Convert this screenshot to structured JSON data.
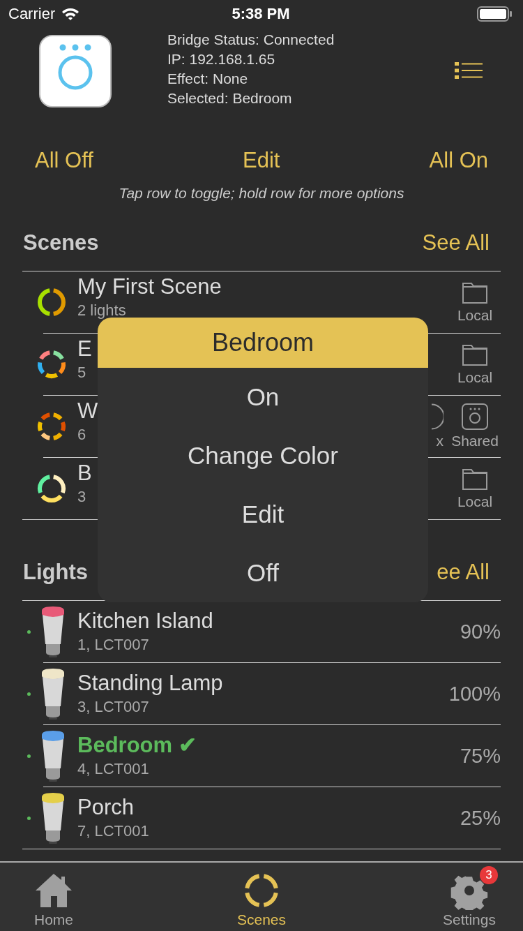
{
  "status_bar": {
    "carrier": "Carrier",
    "time": "5:38 PM"
  },
  "bridge": {
    "lines": [
      "Bridge Status: Connected",
      "IP: 192.168.1.65",
      "Effect: None",
      "Selected: Bedroom"
    ]
  },
  "actions": [
    "All Off",
    "Edit",
    "All On"
  ],
  "hint": "Tap row to toggle; hold row for more options",
  "scenes": {
    "title": "Scenes",
    "see_all": "See All",
    "rows": [
      {
        "name": "My First Scene",
        "subtitle": "2 lights",
        "segments": [
          {
            "color": "#e09a00"
          },
          {
            "color": "#a8e000"
          }
        ],
        "kind": "local",
        "label": "Local"
      },
      {
        "name": "E",
        "subtitle": "5",
        "segments": [
          {
            "color": "#88e0a0"
          },
          {
            "color": "#ff8c1a"
          },
          {
            "color": "#f0c000"
          },
          {
            "color": "#30b0f0"
          },
          {
            "color": "#ff8080"
          }
        ],
        "kind": "local",
        "label": "Local"
      },
      {
        "name": "W",
        "subtitle": "6",
        "segments": [
          {
            "color": "#f0b000"
          },
          {
            "color": "#e05000"
          },
          {
            "color": "#f0b000"
          },
          {
            "color": "#ffc880"
          },
          {
            "color": "#f0c000"
          },
          {
            "color": "#e05000"
          }
        ],
        "kind": "shared",
        "label": "Shared",
        "extra_label": "x"
      },
      {
        "name": "B",
        "subtitle": "3",
        "segments": [
          {
            "color": "#fff0c0"
          },
          {
            "color": "#ffe060"
          },
          {
            "color": "#60f0a0"
          }
        ],
        "kind": "local",
        "label": "Local"
      }
    ]
  },
  "lights": {
    "title": "Lights",
    "see_all": "ee All",
    "rows": [
      {
        "name": "Kitchen Island",
        "subtitle": "1, LCT007",
        "percent": "90%",
        "on": true,
        "selected": false,
        "color": "#e85a78"
      },
      {
        "name": "Standing Lamp",
        "subtitle": "3, LCT007",
        "percent": "100%",
        "on": true,
        "selected": false,
        "color": "#efe6c8"
      },
      {
        "name": "Bedroom ✔",
        "subtitle": "4, LCT001",
        "percent": "75%",
        "on": true,
        "selected": true,
        "color": "#5a9ee8"
      },
      {
        "name": "Porch",
        "subtitle": "7, LCT001",
        "percent": "25%",
        "on": true,
        "selected": false,
        "color": "#e4cf4a"
      }
    ]
  },
  "popup": {
    "title": "Bedroom",
    "items": [
      "On",
      "Change Color",
      "Edit",
      "Off"
    ]
  },
  "tabs": [
    {
      "label": "Home",
      "kind": "home",
      "selected": false
    },
    {
      "label": "Scenes",
      "kind": "scenes",
      "selected": true
    },
    {
      "label": "Settings",
      "kind": "settings",
      "selected": false,
      "badge": "3"
    }
  ]
}
